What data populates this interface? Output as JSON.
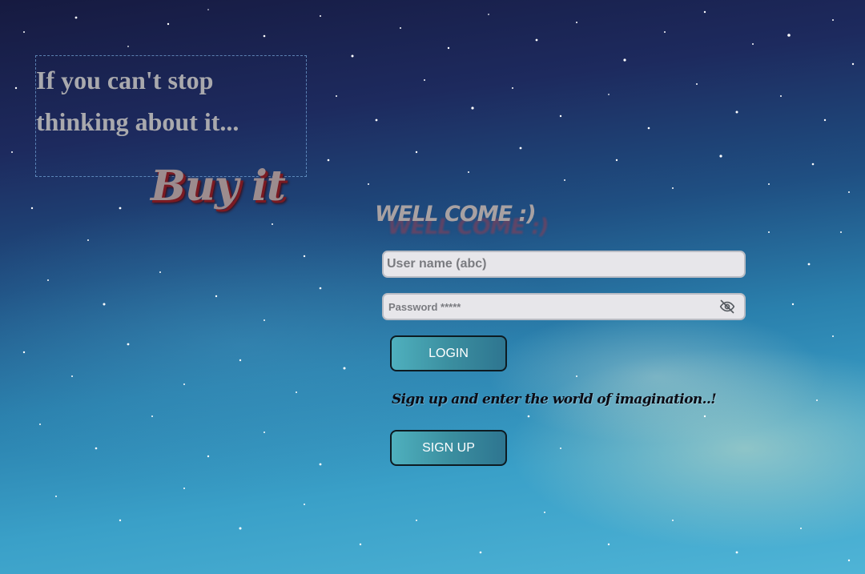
{
  "hero": {
    "quote_line1": "If you can't stop",
    "quote_line2": "thinking about it...",
    "slogan": "Buy it"
  },
  "login_form": {
    "welcome": "WELL COME :)",
    "username_placeholder": "User name (abc)",
    "password_placeholder": "Password *****",
    "password_toggle_icon": "eye-off-icon",
    "login_label": "LOGIN",
    "signup_prompt": "Sign up and  enter the world of imagination..!",
    "signup_label": "SIGN UP"
  },
  "colors": {
    "button_gradient_start": "#4fb0be",
    "button_gradient_end": "#2e7590",
    "quote_text": "#a9a9ad",
    "slogan_shadow": "#7a1a22"
  }
}
